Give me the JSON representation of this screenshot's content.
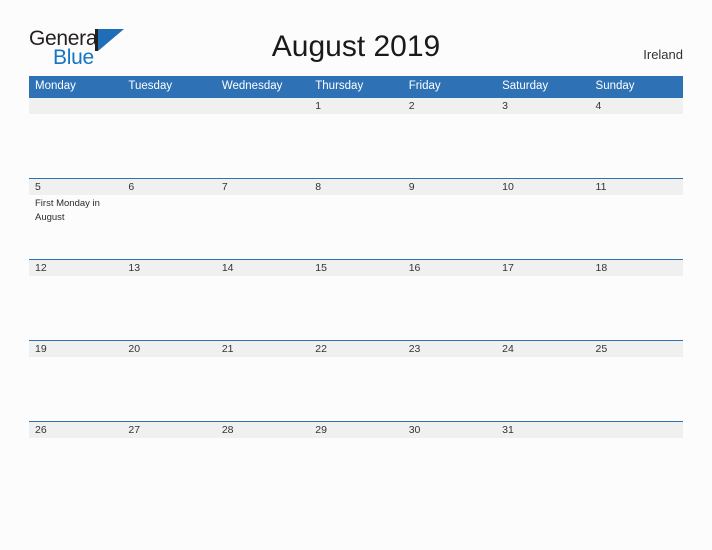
{
  "brand": {
    "word_one": "General",
    "word_two": "Blue",
    "accent_color": "#1574c4",
    "triangle_color": "#1e6fb8",
    "bar_color": "#231f20"
  },
  "header": {
    "title": "August 2019",
    "country": "Ireland"
  },
  "theme": {
    "header_blue": "#2e71b5",
    "band_gray": "#f0f0f0",
    "page_background": "#fcfcfc",
    "separator_blue": "#2e71b5",
    "date_text": "#333333"
  },
  "calendar": {
    "weekdays": [
      "Monday",
      "Tuesday",
      "Wednesday",
      "Thursday",
      "Friday",
      "Saturday",
      "Sunday"
    ],
    "weeks": [
      {
        "days": [
          {
            "date": "",
            "event": ""
          },
          {
            "date": "",
            "event": ""
          },
          {
            "date": "",
            "event": ""
          },
          {
            "date": "1",
            "event": ""
          },
          {
            "date": "2",
            "event": ""
          },
          {
            "date": "3",
            "event": ""
          },
          {
            "date": "4",
            "event": ""
          }
        ]
      },
      {
        "days": [
          {
            "date": "5",
            "event": "First Monday in August"
          },
          {
            "date": "6",
            "event": ""
          },
          {
            "date": "7",
            "event": ""
          },
          {
            "date": "8",
            "event": ""
          },
          {
            "date": "9",
            "event": ""
          },
          {
            "date": "10",
            "event": ""
          },
          {
            "date": "11",
            "event": ""
          }
        ]
      },
      {
        "days": [
          {
            "date": "12",
            "event": ""
          },
          {
            "date": "13",
            "event": ""
          },
          {
            "date": "14",
            "event": ""
          },
          {
            "date": "15",
            "event": ""
          },
          {
            "date": "16",
            "event": ""
          },
          {
            "date": "17",
            "event": ""
          },
          {
            "date": "18",
            "event": ""
          }
        ]
      },
      {
        "days": [
          {
            "date": "19",
            "event": ""
          },
          {
            "date": "20",
            "event": ""
          },
          {
            "date": "21",
            "event": ""
          },
          {
            "date": "22",
            "event": ""
          },
          {
            "date": "23",
            "event": ""
          },
          {
            "date": "24",
            "event": ""
          },
          {
            "date": "25",
            "event": ""
          }
        ]
      },
      {
        "days": [
          {
            "date": "26",
            "event": ""
          },
          {
            "date": "27",
            "event": ""
          },
          {
            "date": "28",
            "event": ""
          },
          {
            "date": "29",
            "event": ""
          },
          {
            "date": "30",
            "event": ""
          },
          {
            "date": "31",
            "event": ""
          },
          {
            "date": "",
            "event": ""
          }
        ]
      }
    ]
  }
}
